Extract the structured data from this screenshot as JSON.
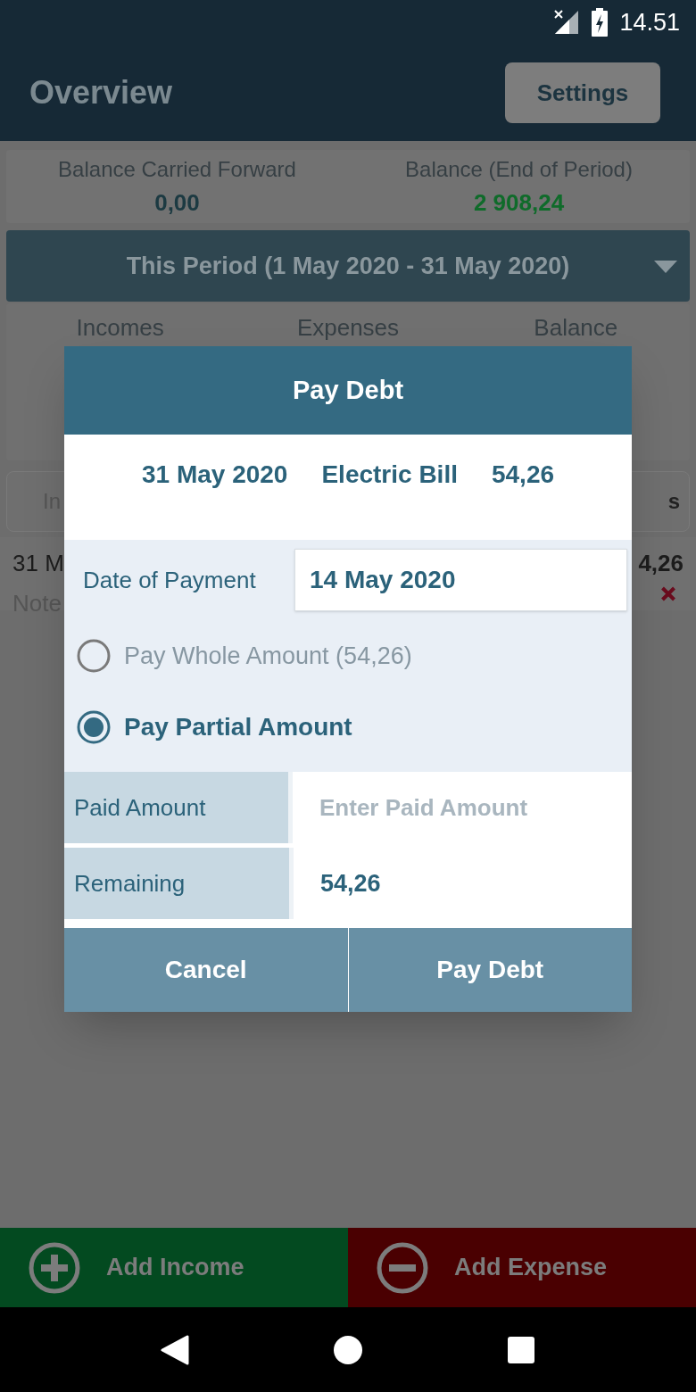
{
  "status_bar": {
    "time": "14.51"
  },
  "header": {
    "title": "Overview",
    "settings_button": "Settings"
  },
  "summary": [
    {
      "label": "Balance Carried Forward",
      "value": "0,00",
      "color": "#1c3a42"
    },
    {
      "label": "Balance (End of Period)",
      "value": "2 908,24",
      "color": "#0f6b2a"
    }
  ],
  "period": {
    "label": "This Period (1 May 2020 - 31 May 2020)"
  },
  "totals_columns": [
    "Incomes",
    "Expenses",
    "Balance"
  ],
  "tab_headers": [
    "In",
    "s"
  ],
  "entry": {
    "date": "31 M",
    "note": "Note",
    "amount": "4,26"
  },
  "dialog": {
    "title": "Pay Debt",
    "debt": {
      "date": "31 May 2020",
      "name": "Electric Bill",
      "amount": "54,26"
    },
    "payment_date": {
      "label": "Date of Payment",
      "value": "14 May 2020"
    },
    "options": [
      {
        "label": "Pay Whole Amount (54,26)",
        "selected": false
      },
      {
        "label": "Pay Partial Amount",
        "selected": true
      }
    ],
    "paid_amount": {
      "label": "Paid Amount",
      "placeholder": "Enter Paid Amount"
    },
    "remaining": {
      "label": "Remaining",
      "value": "54,26"
    },
    "buttons": [
      "Cancel",
      "Pay Debt"
    ]
  },
  "bottom_actions": [
    {
      "label": "Add Income",
      "kind": "income"
    },
    {
      "label": "Add Expense",
      "kind": "expense"
    }
  ]
}
